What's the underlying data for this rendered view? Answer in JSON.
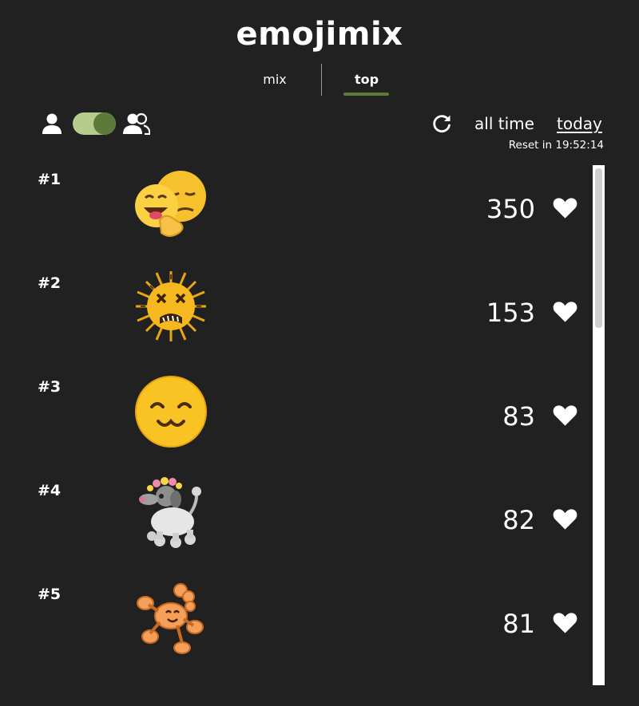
{
  "app": {
    "title": "emojimix"
  },
  "tabs": [
    {
      "label": "mix",
      "active": false
    },
    {
      "label": "top",
      "active": true
    }
  ],
  "controls": {
    "mode_toggle": {
      "left_icon": "user-icon",
      "right_icon": "users-icon",
      "state": "right"
    },
    "refresh_icon": "refresh-icon",
    "periods": [
      {
        "label": "all time",
        "selected": false
      },
      {
        "label": "today",
        "selected": true
      }
    ],
    "reset_text": "Reset in 19:52:14"
  },
  "leaderboard": [
    {
      "rank": "#1",
      "emoji": "smiling-face-with-hand-over-mouth-mixed-with-relieved-face",
      "likes": "350"
    },
    {
      "rank": "#2",
      "emoji": "dizzy-face-mixed-with-porcupine-spikes",
      "likes": "153"
    },
    {
      "rank": "#3",
      "emoji": "smiling-face-with-closed-eyes-mixed",
      "likes": "83"
    },
    {
      "rank": "#4",
      "emoji": "poodle-with-flower-crown",
      "likes": "82"
    },
    {
      "rank": "#5",
      "emoji": "smiling-orange-scorpion",
      "likes": "81"
    }
  ],
  "colors": {
    "background": "#212121",
    "accent": "#5d7a3a",
    "toggle_track": "#b5cc8c",
    "text": "#ffffff"
  },
  "icons": {
    "like": "heart-icon"
  }
}
